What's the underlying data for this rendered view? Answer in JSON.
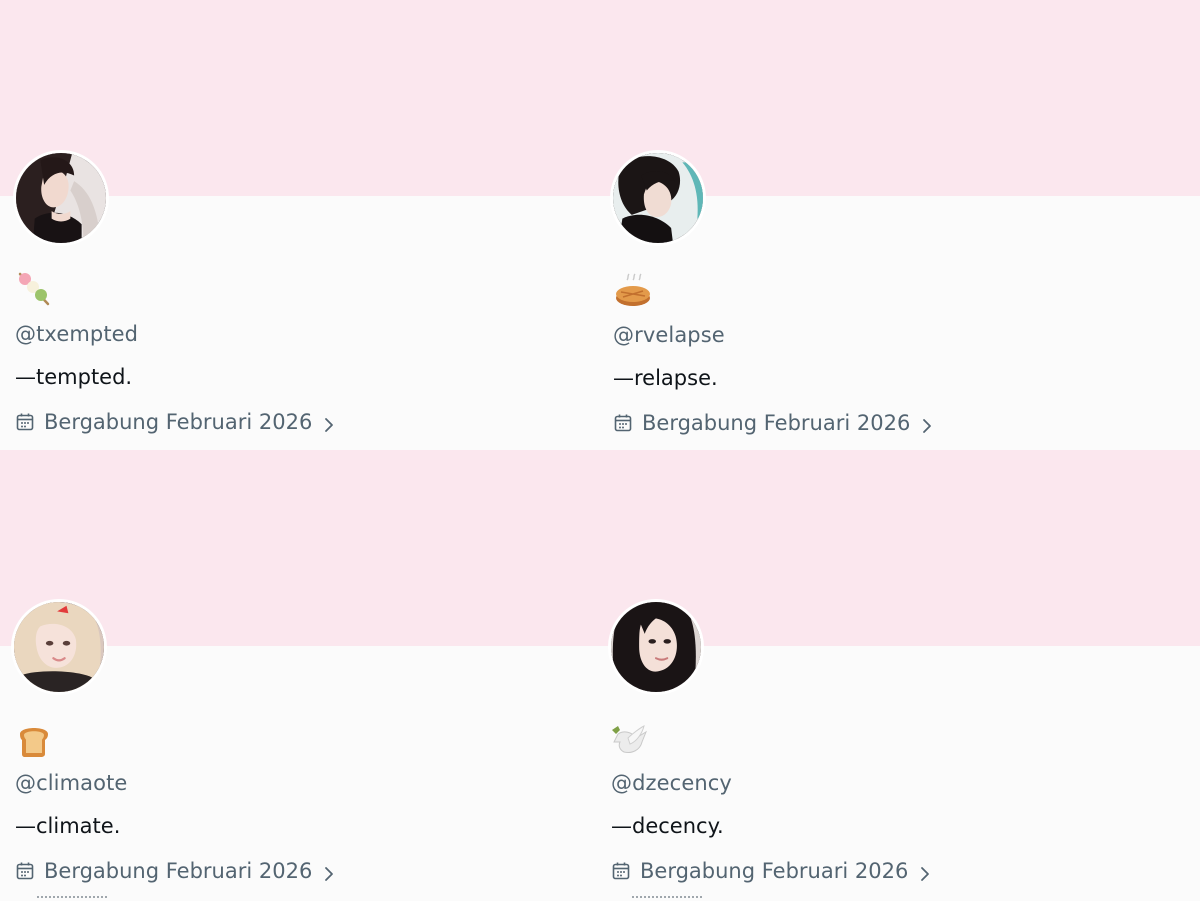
{
  "colors": {
    "banner": "#fbe7ee",
    "background": "#fbfbfb",
    "handle_text": "#536471",
    "bio_text": "#0f1419"
  },
  "profiles": [
    {
      "emoji": "dango-emoji",
      "handle": "@txempted",
      "bio": "—tempted.",
      "joined": "Bergabung Februari 2026"
    },
    {
      "emoji": "pie-emoji",
      "handle": "@rvelapse",
      "bio": "—relapse.",
      "joined": "Bergabung Februari 2026"
    },
    {
      "emoji": "bread-emoji",
      "handle": "@climaote",
      "bio": "—climate.",
      "joined": "Bergabung Februari 2026"
    },
    {
      "emoji": "dove-emoji",
      "handle": "@dzecency",
      "bio": "—decency.",
      "joined": "Bergabung Februari 2026"
    }
  ]
}
